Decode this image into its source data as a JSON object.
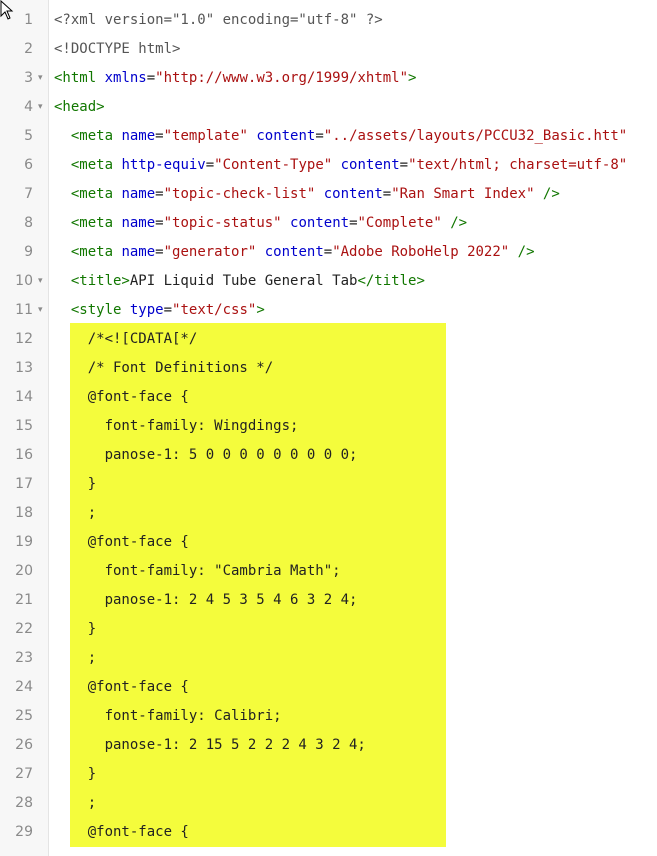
{
  "editor": {
    "highlight_color": "#f4fc3c",
    "fold_icon": "caret-down-icon",
    "lines": [
      {
        "n": "1",
        "fold": "",
        "tokens": [
          {
            "t": "<?xml version=\"1.0\" encoding=\"utf-8\" ?>",
            "c": "meta"
          }
        ]
      },
      {
        "n": "2",
        "fold": "",
        "tokens": [
          {
            "t": "<!DOCTYPE html>",
            "c": "meta"
          }
        ]
      },
      {
        "n": "3",
        "fold": "▾",
        "tokens": [
          {
            "t": "<html",
            "c": "tag"
          },
          {
            "t": " xmlns",
            "c": "attr"
          },
          {
            "t": "=",
            "c": "plain"
          },
          {
            "t": "\"http://www.w3.org/1999/xhtml\"",
            "c": "str"
          },
          {
            "t": ">",
            "c": "tag"
          }
        ]
      },
      {
        "n": "4",
        "fold": "▾",
        "tokens": [
          {
            "t": "<head>",
            "c": "tag"
          }
        ]
      },
      {
        "n": "5",
        "fold": "",
        "tokens": [
          {
            "t": "  <meta",
            "c": "tag"
          },
          {
            "t": " name",
            "c": "attr"
          },
          {
            "t": "=",
            "c": "plain"
          },
          {
            "t": "\"template\"",
            "c": "str"
          },
          {
            "t": " content",
            "c": "attr"
          },
          {
            "t": "=",
            "c": "plain"
          },
          {
            "t": "\"../assets/layouts/PCCU32_Basic.htt\"",
            "c": "str"
          }
        ]
      },
      {
        "n": "6",
        "fold": "",
        "tokens": [
          {
            "t": "  <meta",
            "c": "tag"
          },
          {
            "t": " http-equiv",
            "c": "attr"
          },
          {
            "t": "=",
            "c": "plain"
          },
          {
            "t": "\"Content-Type\"",
            "c": "str"
          },
          {
            "t": " content",
            "c": "attr"
          },
          {
            "t": "=",
            "c": "plain"
          },
          {
            "t": "\"text/html; charset=utf-8\"",
            "c": "str"
          }
        ]
      },
      {
        "n": "7",
        "fold": "",
        "tokens": [
          {
            "t": "  <meta",
            "c": "tag"
          },
          {
            "t": " name",
            "c": "attr"
          },
          {
            "t": "=",
            "c": "plain"
          },
          {
            "t": "\"topic-check-list\"",
            "c": "str"
          },
          {
            "t": " content",
            "c": "attr"
          },
          {
            "t": "=",
            "c": "plain"
          },
          {
            "t": "\"Ran Smart Index\"",
            "c": "str"
          },
          {
            "t": " />",
            "c": "tag"
          }
        ]
      },
      {
        "n": "8",
        "fold": "",
        "tokens": [
          {
            "t": "  <meta",
            "c": "tag"
          },
          {
            "t": " name",
            "c": "attr"
          },
          {
            "t": "=",
            "c": "plain"
          },
          {
            "t": "\"topic-status\"",
            "c": "str"
          },
          {
            "t": " content",
            "c": "attr"
          },
          {
            "t": "=",
            "c": "plain"
          },
          {
            "t": "\"Complete\"",
            "c": "str"
          },
          {
            "t": " />",
            "c": "tag"
          }
        ]
      },
      {
        "n": "9",
        "fold": "",
        "tokens": [
          {
            "t": "  <meta",
            "c": "tag"
          },
          {
            "t": " name",
            "c": "attr"
          },
          {
            "t": "=",
            "c": "plain"
          },
          {
            "t": "\"generator\"",
            "c": "str"
          },
          {
            "t": " content",
            "c": "attr"
          },
          {
            "t": "=",
            "c": "plain"
          },
          {
            "t": "\"Adobe RoboHelp 2022\"",
            "c": "str"
          },
          {
            "t": " />",
            "c": "tag"
          }
        ]
      },
      {
        "n": "10",
        "fold": "▾",
        "tokens": [
          {
            "t": "  <title>",
            "c": "tag"
          },
          {
            "t": "API Liquid Tube General Tab",
            "c": "plain"
          },
          {
            "t": "</title>",
            "c": "tag"
          }
        ]
      },
      {
        "n": "11",
        "fold": "▾",
        "tokens": [
          {
            "t": "  <style",
            "c": "tag"
          },
          {
            "t": " type",
            "c": "attr"
          },
          {
            "t": "=",
            "c": "plain"
          },
          {
            "t": "\"text/css\"",
            "c": "str"
          },
          {
            "t": ">",
            "c": "tag"
          }
        ]
      },
      {
        "n": "12",
        "fold": "",
        "tokens": [
          {
            "t": "    /*<![CDATA[*/",
            "c": "plain"
          }
        ]
      },
      {
        "n": "13",
        "fold": "",
        "tokens": [
          {
            "t": "    /* Font Definitions */",
            "c": "plain"
          }
        ]
      },
      {
        "n": "14",
        "fold": "",
        "tokens": [
          {
            "t": "    @font-face {",
            "c": "plain"
          }
        ]
      },
      {
        "n": "15",
        "fold": "",
        "tokens": [
          {
            "t": "      font-family: Wingdings;",
            "c": "plain"
          }
        ]
      },
      {
        "n": "16",
        "fold": "",
        "tokens": [
          {
            "t": "      panose-1: 5 0 0 0 0 0 0 0 0 0;",
            "c": "plain"
          }
        ]
      },
      {
        "n": "17",
        "fold": "",
        "tokens": [
          {
            "t": "    }",
            "c": "plain"
          }
        ]
      },
      {
        "n": "18",
        "fold": "",
        "tokens": [
          {
            "t": "    ;",
            "c": "plain"
          }
        ]
      },
      {
        "n": "19",
        "fold": "",
        "tokens": [
          {
            "t": "    @font-face {",
            "c": "plain"
          }
        ]
      },
      {
        "n": "20",
        "fold": "",
        "tokens": [
          {
            "t": "      font-family: \"Cambria Math\";",
            "c": "plain"
          }
        ]
      },
      {
        "n": "21",
        "fold": "",
        "tokens": [
          {
            "t": "      panose-1: 2 4 5 3 5 4 6 3 2 4;",
            "c": "plain"
          }
        ]
      },
      {
        "n": "22",
        "fold": "",
        "tokens": [
          {
            "t": "    }",
            "c": "plain"
          }
        ]
      },
      {
        "n": "23",
        "fold": "",
        "tokens": [
          {
            "t": "    ;",
            "c": "plain"
          }
        ]
      },
      {
        "n": "24",
        "fold": "",
        "tokens": [
          {
            "t": "    @font-face {",
            "c": "plain"
          }
        ]
      },
      {
        "n": "25",
        "fold": "",
        "tokens": [
          {
            "t": "      font-family: Calibri;",
            "c": "plain"
          }
        ]
      },
      {
        "n": "26",
        "fold": "",
        "tokens": [
          {
            "t": "      panose-1: 2 15 5 2 2 2 4 3 2 4;",
            "c": "plain"
          }
        ]
      },
      {
        "n": "27",
        "fold": "",
        "tokens": [
          {
            "t": "    }",
            "c": "plain"
          }
        ]
      },
      {
        "n": "28",
        "fold": "",
        "tokens": [
          {
            "t": "    ;",
            "c": "plain"
          }
        ]
      },
      {
        "n": "29",
        "fold": "",
        "tokens": [
          {
            "t": "    @font-face {",
            "c": "plain"
          }
        ]
      }
    ]
  }
}
